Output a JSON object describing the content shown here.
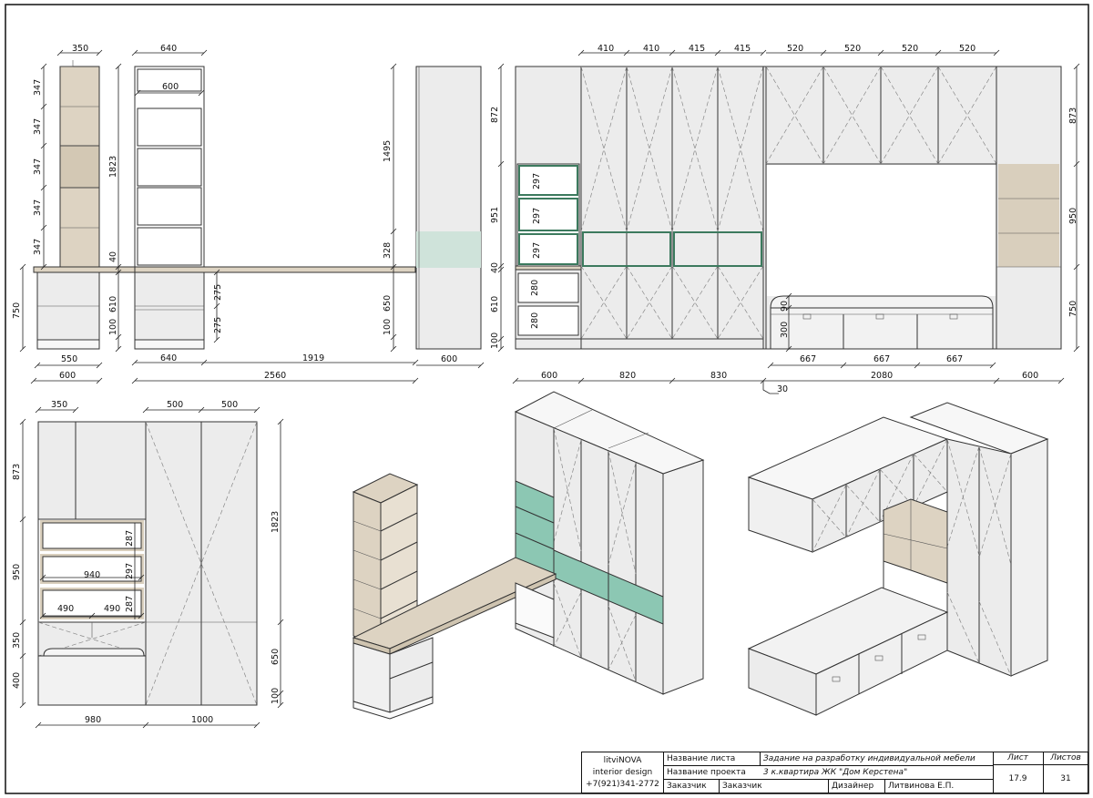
{
  "drawing": {
    "dimensions": {
      "shelf_width": "350",
      "shelf_top_depth": "640",
      "shelf_inner": "600",
      "shelf_heights": [
        "347",
        "347",
        "347",
        "347",
        "347"
      ],
      "shelf_total": "1823",
      "desk_top": "40",
      "desk_leg": "610",
      "base": "100",
      "desk_total": "750",
      "drawer_heights": [
        "275",
        "275"
      ],
      "side_bottom": [
        "550",
        "600"
      ],
      "front_bottom": [
        "640",
        "1919",
        "2560"
      ],
      "wall_heights": [
        "1495",
        "328",
        "650",
        "100"
      ],
      "wall_bottom": "600",
      "elev_top": [
        "410",
        "410",
        "415",
        "415",
        "520",
        "520",
        "520",
        "520"
      ],
      "elev_left": [
        "872",
        "951",
        "40",
        "610",
        "100"
      ],
      "cubby_heights": [
        "297",
        "297",
        "297",
        "280",
        "280"
      ],
      "elev_right": [
        "873",
        "950",
        "750"
      ],
      "bed_heights": [
        "90",
        "300"
      ],
      "drawer_widths": [
        "667",
        "667",
        "667"
      ],
      "elev_bottom": [
        "600",
        "820",
        "830",
        "2080",
        "600"
      ],
      "offset": "30",
      "side2_top": [
        "350",
        "500",
        "500"
      ],
      "side2_left": [
        "873",
        "950",
        "350",
        "400"
      ],
      "side2_mid": [
        "287",
        "297",
        "287"
      ],
      "side2_inner": [
        "940",
        "490",
        "490"
      ],
      "side2_right": [
        "1823",
        "650",
        "100"
      ],
      "side2_bottom": [
        "980",
        "1000"
      ]
    }
  },
  "title_block": {
    "company": "litviNOVA",
    "company_sub": "interior design",
    "phone": "+7(921)341-2772",
    "sheet_name_label": "Название листа",
    "sheet_name_value": "Задание на разработку индивидуальной мебели",
    "project_label": "Название проекта",
    "project_value": "3 к.квартира ЖК \"Дом Керстена\"",
    "client_label": "Заказчик",
    "client_value": "Заказчик",
    "designer_label": "Дизайнер",
    "designer_value": "Литвинова Е.П.",
    "sheet_label": "Лист",
    "sheet_value": "17.9",
    "sheets_label": "Листов",
    "sheets_value": "31"
  },
  "colors": {
    "panel": "#ececec",
    "wood": "#ddd3c2",
    "glass_green": "#cfe3da",
    "teal": "#8cc7b3",
    "frame_green": "#3c7a5e",
    "line": "#333333"
  }
}
